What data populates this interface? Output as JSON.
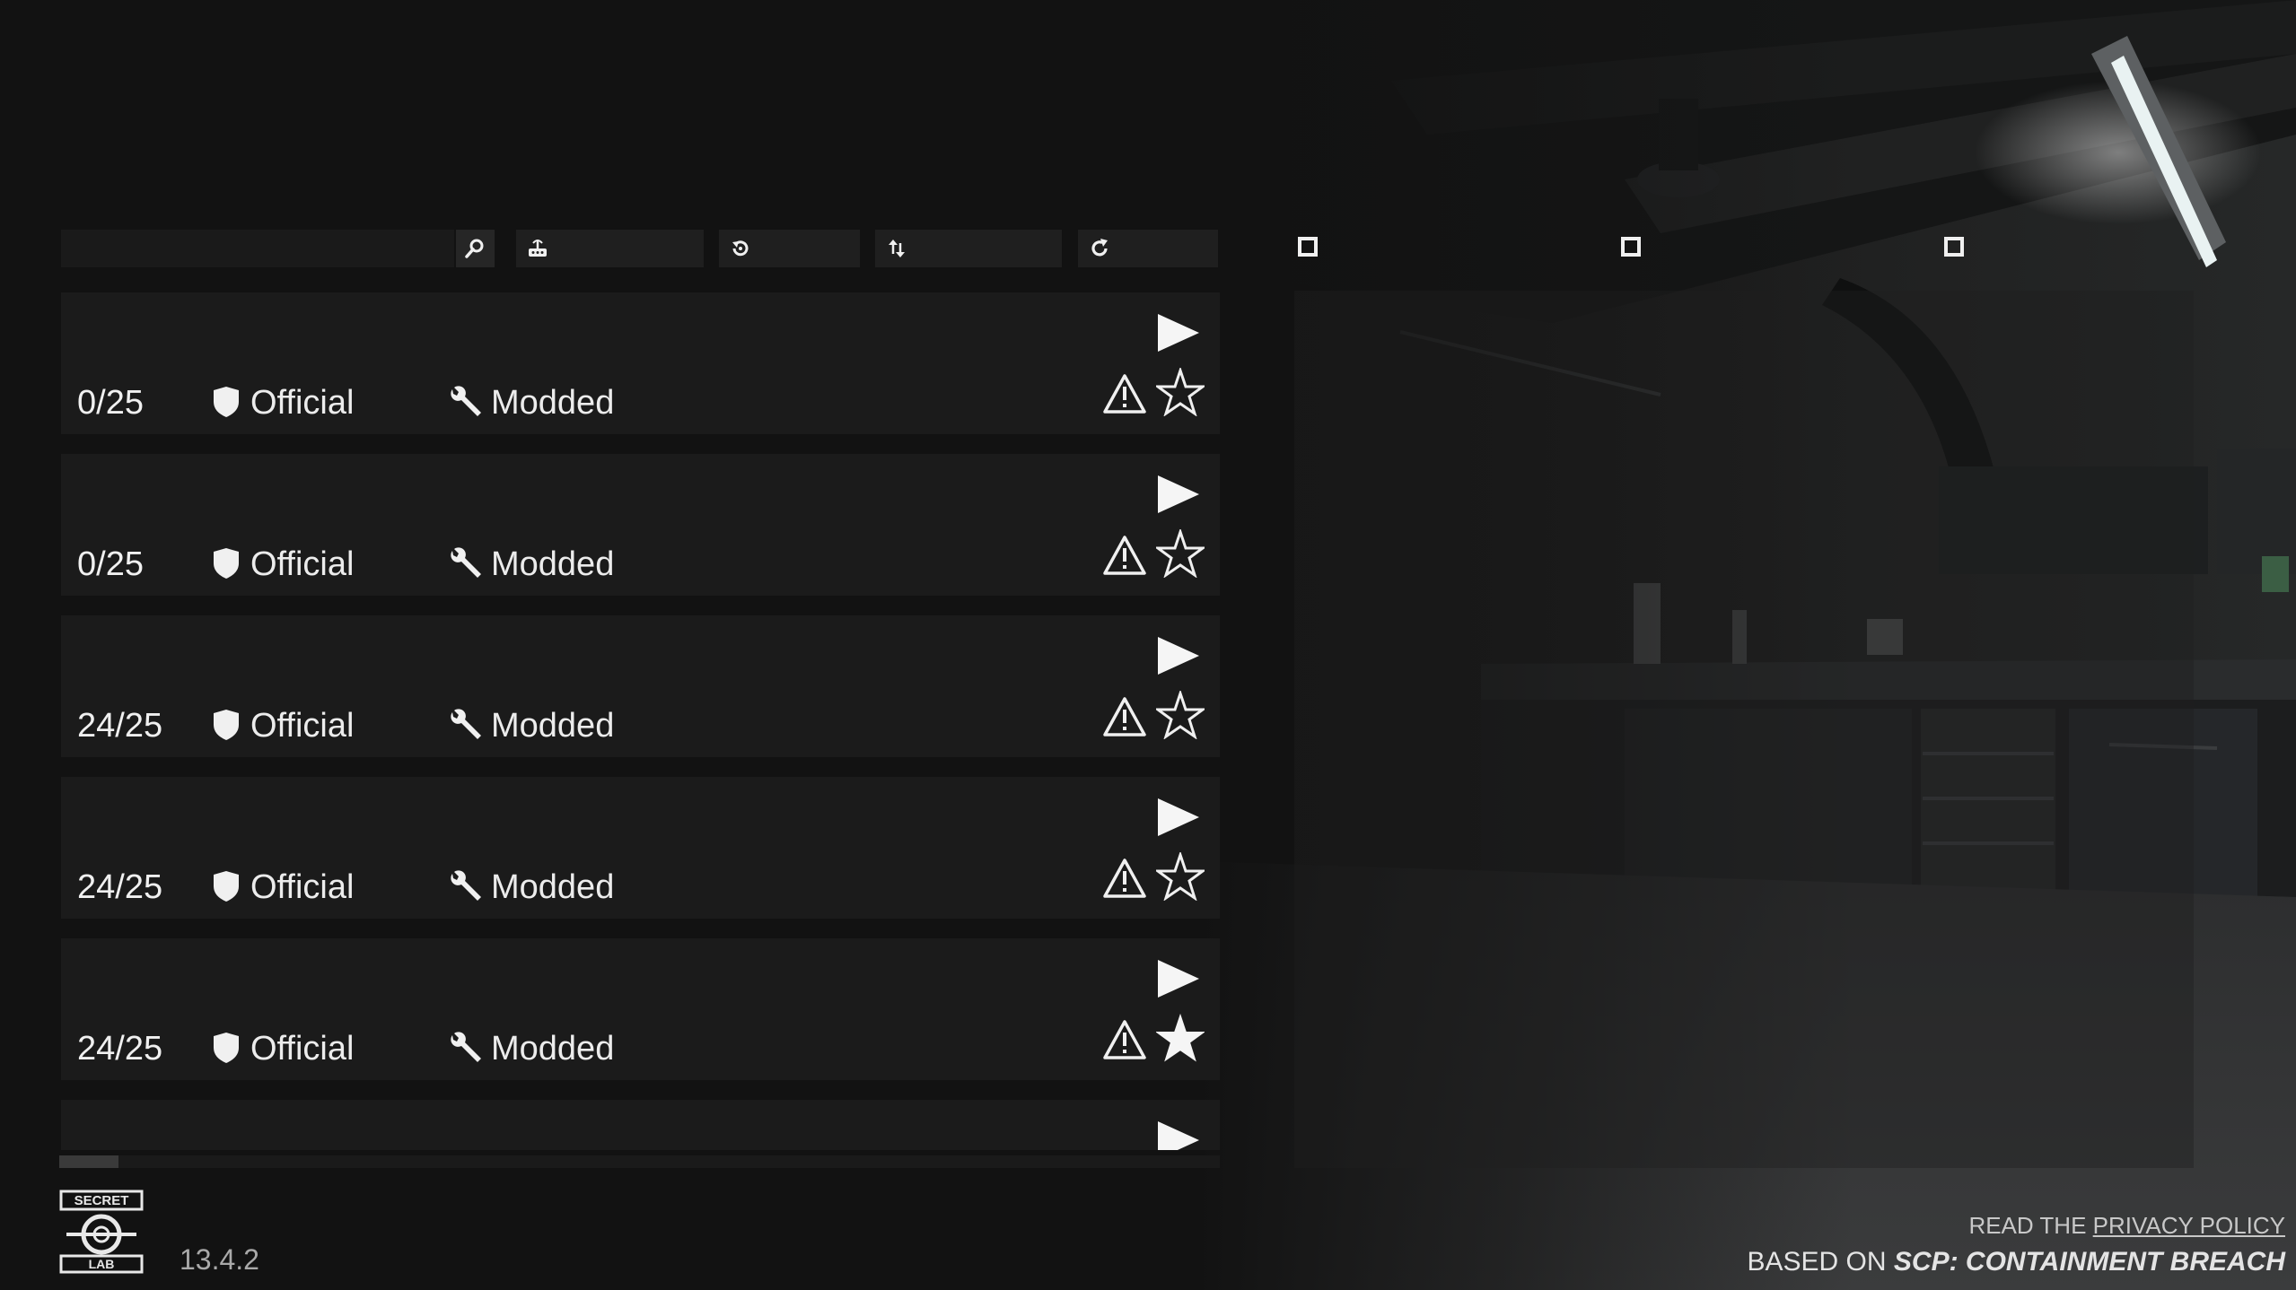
{
  "toolbar": {
    "search_placeholder": "",
    "filter_label": "",
    "history_label": "",
    "sort_label": "",
    "refresh_label": ""
  },
  "servers": [
    {
      "players": "0/25",
      "official": "Official",
      "modded": "Modded",
      "favorite": false
    },
    {
      "players": "0/25",
      "official": "Official",
      "modded": "Modded",
      "favorite": false
    },
    {
      "players": "24/25",
      "official": "Official",
      "modded": "Modded",
      "favorite": false
    },
    {
      "players": "24/25",
      "official": "Official",
      "modded": "Modded",
      "favorite": false
    },
    {
      "players": "24/25",
      "official": "Official",
      "modded": "Modded",
      "favorite": true
    }
  ],
  "icons": {
    "search": "magnifier-icon",
    "filter": "router-icon",
    "history": "history-icon",
    "sort": "sort-icon",
    "refresh": "refresh-icon",
    "official": "shield-icon",
    "modded": "wrench-icon",
    "play": "play-icon",
    "report": "warning-icon",
    "favorite": "star-icon"
  },
  "footer": {
    "logo_top": "SECRET",
    "logo_bottom": "LAB",
    "version": "13.4.2",
    "privacy_prefix": "READ THE ",
    "privacy_link": "PRIVACY POLICY",
    "based_prefix": "BASED ON ",
    "based_title": "SCP: CONTAINMENT BREACH"
  },
  "colors": {
    "background": "#121212",
    "row": "#1b1b1b",
    "toolbar": "#1f1f1f",
    "text": "#ececec"
  }
}
